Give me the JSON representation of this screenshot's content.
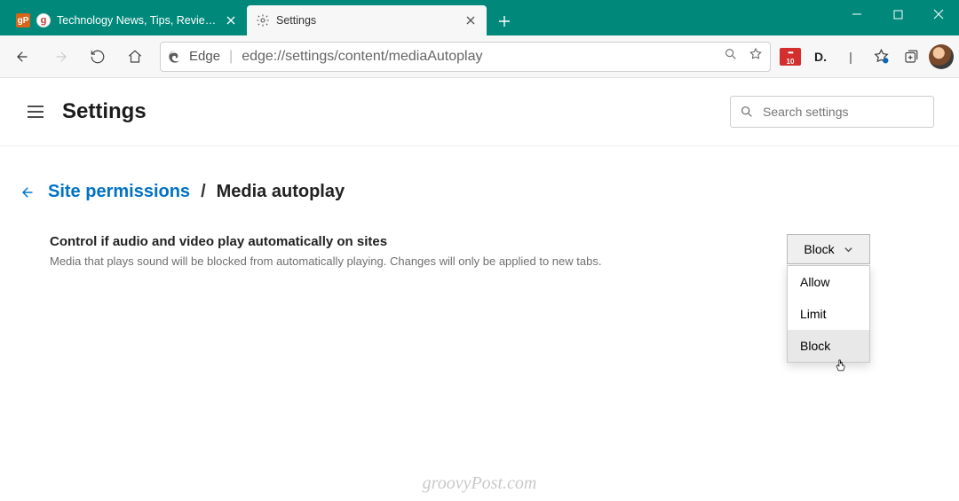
{
  "tabs": [
    {
      "title": "Technology News, Tips, Reviews.",
      "favicon1": "gP",
      "favicon2": "g"
    },
    {
      "title": "Settings"
    }
  ],
  "url_identity": "Edge",
  "url": "edge://settings/content/mediaAutoplay",
  "ext": {
    "lastpass_badge": "10",
    "dark": "D."
  },
  "settings": {
    "title": "Settings",
    "search_placeholder": "Search settings"
  },
  "breadcrumb": {
    "parent": "Site permissions",
    "sep": "/",
    "current": "Media autoplay"
  },
  "row": {
    "heading": "Control if audio and video play automatically on sites",
    "desc": "Media that plays sound will be blocked from automatically playing. Changes will only be applied to new tabs."
  },
  "dropdown": {
    "selected": "Block",
    "options": [
      "Allow",
      "Limit",
      "Block"
    ]
  },
  "watermark": "groovyPost.com"
}
